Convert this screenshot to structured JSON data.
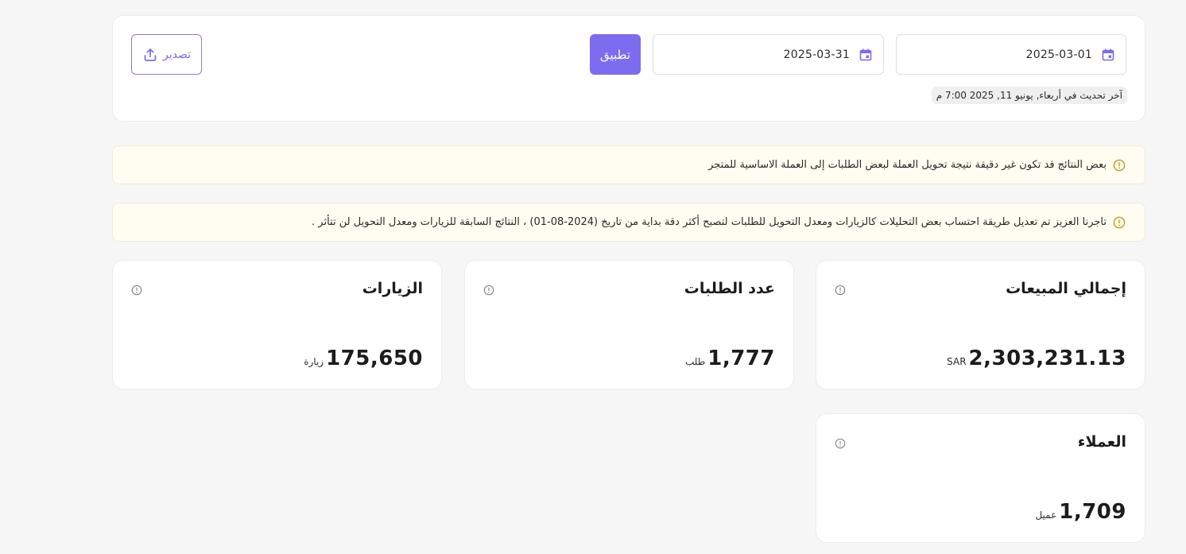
{
  "filters": {
    "start_date": "2025-03-01",
    "end_date": "2025-03-31",
    "apply_label": "تطبيق",
    "export_label": "تصدير",
    "last_update": "آخر تحديث في أربعاء, يونيو 11, 2025 7:00 م"
  },
  "notices": [
    {
      "text": "بعض النتائج قد تكون غير دقيقة نتيجة تحويل العملة لبعض الطلبات إلى العملة الاساسية للمتجر"
    },
    {
      "text": "تاجرنا العزيز تم تعديل طريقة احتساب بعض التحليلات كالزيارات ومعدل التحويل للطلبات لتصبح أكثر دقة بداية من تاريخ (2024-08-01) ، النتائج السابقة للزيارات ومعدل التحويل لن تتأثر ."
    }
  ],
  "stats": {
    "sales": {
      "title": "إجمالي المبيعات",
      "value": "2,303,231.13",
      "unit": "SAR"
    },
    "orders": {
      "title": "عدد الطلبات",
      "value": "1,777",
      "unit": "طلب"
    },
    "visits": {
      "title": "الزيارات",
      "value": "175,650",
      "unit": "زيارة"
    },
    "customers": {
      "title": "العملاء",
      "value": "1,709",
      "unit": "عميل"
    }
  },
  "icons": {
    "calendar": "calendar-icon",
    "export": "upload-icon",
    "warning": "warning-circle-icon",
    "info": "info-circle-icon"
  },
  "colors": {
    "accent": "#7c6cf0",
    "notice_bg": "#fffcf1",
    "warning_icon": "#c9a227"
  }
}
